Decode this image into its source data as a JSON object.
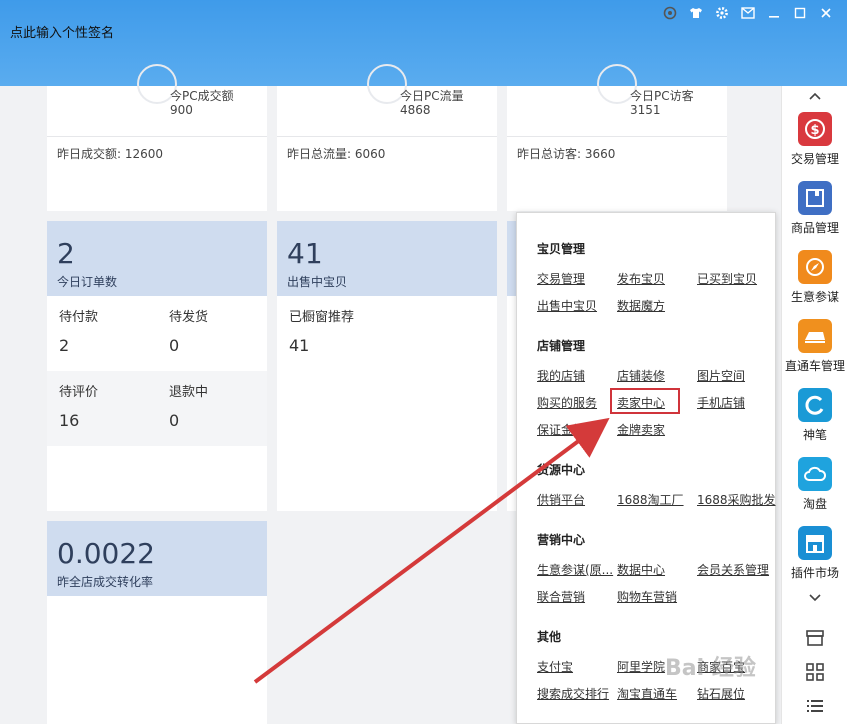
{
  "header": {
    "signature": "点此输入个性签名",
    "controls": [
      "skin-icon",
      "shirt-icon",
      "gear-icon",
      "mail-icon",
      "minimize-icon",
      "maximize-icon",
      "close-icon"
    ]
  },
  "stats_top": [
    {
      "label": "今PC成交额",
      "value": "900",
      "footer": "昨日成交额: 12600"
    },
    {
      "label": "今日PC流量",
      "value": "4868",
      "footer": "昨日总流量: 6060"
    },
    {
      "label": "今日PC访客",
      "value": "3151",
      "footer": "昨日总访客: 3660"
    }
  ],
  "orders": {
    "count": "2",
    "caption": "今日订单数",
    "cells": [
      {
        "label": "待付款",
        "value": "2"
      },
      {
        "label": "待发货",
        "value": "0"
      },
      {
        "label": "待评价",
        "value": "16"
      },
      {
        "label": "退款中",
        "value": "0"
      }
    ]
  },
  "selling": {
    "count": "41",
    "caption": "出售中宝贝",
    "sub_label": "已橱窗推荐",
    "sub_value": "41"
  },
  "conversion": {
    "value": "0.0022",
    "caption": "昨全店成交转化率"
  },
  "popup": {
    "sections": [
      {
        "title": "宝贝管理",
        "links": [
          "交易管理",
          "发布宝贝",
          "已买到宝贝",
          "出售中宝贝",
          "数据魔方"
        ]
      },
      {
        "title": "店铺管理",
        "links": [
          "我的店铺",
          "店铺装修",
          "图片空间",
          "购买的服务",
          "卖家中心",
          "手机店铺",
          "保证金管理",
          "金牌卖家"
        ]
      },
      {
        "title": "货源中心",
        "links": [
          "供销平台",
          "1688淘工厂",
          "1688采购批发"
        ]
      },
      {
        "title": "营销中心",
        "links": [
          "生意参谋(原...",
          "数据中心",
          "会员关系管理",
          "联合营销",
          "购物车营销"
        ]
      },
      {
        "title": "其他",
        "links": [
          "支付宝",
          "阿里学院",
          "商家百宝",
          "搜索成交排行",
          "淘宝直通车",
          "钻石展位"
        ]
      }
    ]
  },
  "sidebar": {
    "items": [
      {
        "label": "交易管理",
        "color": "#d9393e",
        "glyph": "$"
      },
      {
        "label": "商品管理",
        "color": "#3f6fc4",
        "glyph": "▤"
      },
      {
        "label": "生意参谋",
        "color": "#f08a1c",
        "glyph": "◷"
      },
      {
        "label": "直通车管理",
        "color": "#f0901e",
        "glyph": "▰"
      },
      {
        "label": "神笔",
        "color": "#1a9ad6",
        "glyph": "C"
      },
      {
        "label": "淘盘",
        "color": "#1fa3de",
        "glyph": "☁"
      },
      {
        "label": "插件市场",
        "color": "#1a8fd4",
        "glyph": "▦"
      }
    ]
  },
  "watermark": "Bai 经验"
}
